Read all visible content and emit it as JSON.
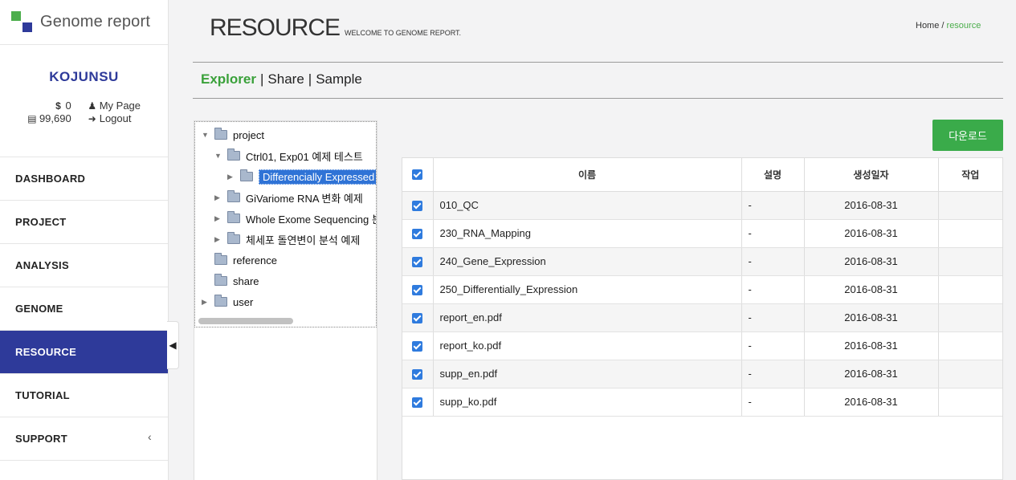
{
  "brand": {
    "name": "Genome report"
  },
  "user": {
    "name": "KOJUNSU",
    "balance": "0",
    "points": "99,690",
    "mypage_label": "My Page",
    "logout_label": "Logout"
  },
  "nav": {
    "items": [
      {
        "label": "DASHBOARD"
      },
      {
        "label": "PROJECT"
      },
      {
        "label": "ANALYSIS"
      },
      {
        "label": "GENOME"
      },
      {
        "label": "RESOURCE",
        "active": true
      },
      {
        "label": "TUTORIAL"
      },
      {
        "label": "SUPPORT",
        "has_submenu": true
      }
    ]
  },
  "header": {
    "title": "RESOURCE",
    "subtitle": "WELCOME TO GENOME REPORT.",
    "breadcrumb": {
      "home": "Home",
      "separator": "/",
      "current": "resource"
    }
  },
  "tabs": [
    {
      "label": "Explorer",
      "active": true
    },
    {
      "label": "Share"
    },
    {
      "label": "Sample"
    }
  ],
  "tree": {
    "nodes": [
      {
        "label": "project",
        "expanded": true
      },
      {
        "label": "Ctrl01, Exp01 예제 테스트",
        "expanded": true
      },
      {
        "label": "Differencially Expressed Genes",
        "selected": true
      },
      {
        "label": "GiVariome RNA 변화 예제"
      },
      {
        "label": "Whole Exome Sequencing 분석"
      },
      {
        "label": "체세포 돌연변이 분석 예제"
      },
      {
        "label": "reference"
      },
      {
        "label": "share"
      },
      {
        "label": "user"
      }
    ]
  },
  "download_label": "다운로드",
  "table": {
    "columns": {
      "name": "이름",
      "desc": "설명",
      "date": "생성일자",
      "action": "작업"
    },
    "rows": [
      {
        "name": "010_QC",
        "desc": "-",
        "date": "2016-08-31",
        "checked": true
      },
      {
        "name": "230_RNA_Mapping",
        "desc": "-",
        "date": "2016-08-31",
        "checked": true
      },
      {
        "name": "240_Gene_Expression",
        "desc": "-",
        "date": "2016-08-31",
        "checked": true
      },
      {
        "name": "250_Differentially_Expression",
        "desc": "-",
        "date": "2016-08-31",
        "checked": true
      },
      {
        "name": "report_en.pdf",
        "desc": "-",
        "date": "2016-08-31",
        "checked": true
      },
      {
        "name": "report_ko.pdf",
        "desc": "-",
        "date": "2016-08-31",
        "checked": true
      },
      {
        "name": "supp_en.pdf",
        "desc": "-",
        "date": "2016-08-31",
        "checked": true
      },
      {
        "name": "supp_ko.pdf",
        "desc": "-",
        "date": "2016-08-31",
        "checked": true
      }
    ]
  },
  "colors": {
    "brand_blue": "#2e3a9a",
    "brand_green": "#4cae4c",
    "button_green": "#3aab4a",
    "checkbox_blue": "#2f7bde"
  }
}
